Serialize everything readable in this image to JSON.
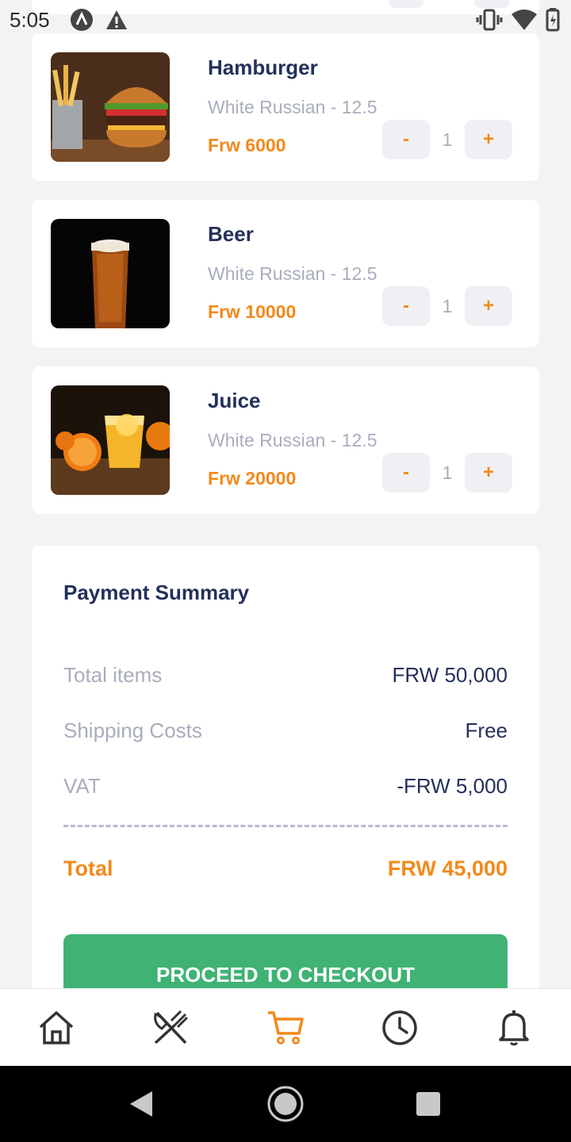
{
  "status_bar": {
    "time": "5:05",
    "left_icons": [
      "a-logo-icon",
      "warning-icon"
    ],
    "right_icons": [
      "vibrate-icon",
      "wifi-icon",
      "battery-icon"
    ]
  },
  "cart": {
    "items": [
      {
        "name": "Hamburger",
        "subtitle": "White Russian - 12.5",
        "price": "Frw 6000",
        "quantity": "1",
        "minus": "-",
        "plus": "+",
        "image": "hamburger-image"
      },
      {
        "name": "Beer",
        "subtitle": "White Russian - 12.5",
        "price": "Frw 10000",
        "quantity": "1",
        "minus": "-",
        "plus": "+",
        "image": "beer-image"
      },
      {
        "name": "Juice",
        "subtitle": "White Russian - 12.5",
        "price": "Frw 20000",
        "quantity": "1",
        "minus": "-",
        "plus": "+",
        "image": "juice-image"
      }
    ]
  },
  "summary": {
    "title": "Payment Summary",
    "rows": [
      {
        "label": "Total items",
        "value": "FRW 50,000"
      },
      {
        "label": "Shipping Costs",
        "value": "Free"
      },
      {
        "label": "VAT",
        "value": "-FRW 5,000"
      }
    ],
    "total_label": "Total",
    "total_value": "FRW 45,000",
    "checkout_label": "PROCEED TO CHECKOUT"
  },
  "bottom_nav": {
    "items": [
      "home-icon",
      "restaurant-icon",
      "cart-icon",
      "clock-icon",
      "bell-icon"
    ],
    "active": "cart-icon"
  },
  "colors": {
    "accent": "#f2891a",
    "navy": "#23305b",
    "muted": "#a9adbd",
    "checkout": "#3fb274",
    "background": "#f2f3f5"
  }
}
